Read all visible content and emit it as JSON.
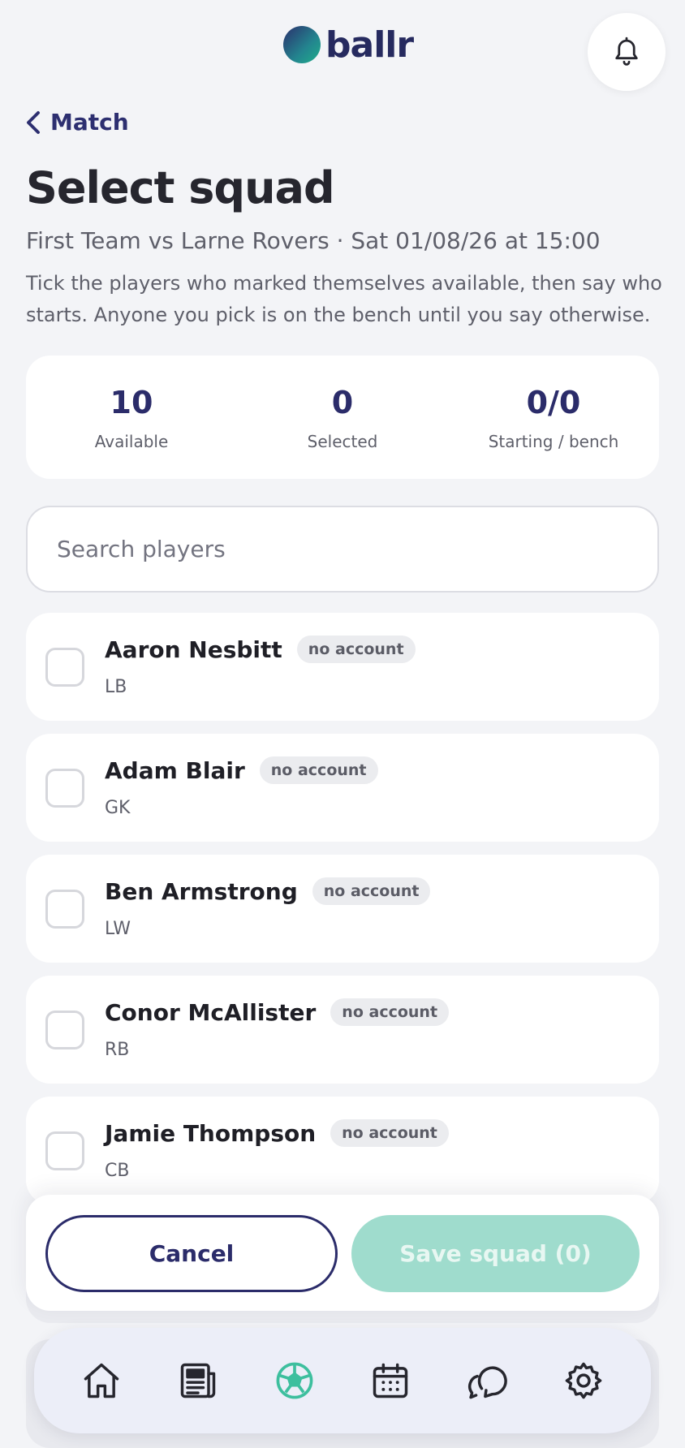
{
  "app": {
    "logo_text": "ballr"
  },
  "header": {
    "back_label": "Match"
  },
  "page": {
    "title": "Select squad",
    "subtitle": "First Team vs Larne Rovers · Sat 01/08/26 at 15:00",
    "description": "Tick the players who marked themselves available, then say who starts. Anyone you pick is on the bench until you say otherwise."
  },
  "stats": [
    {
      "value": "10",
      "label": "Available"
    },
    {
      "value": "0",
      "label": "Selected"
    },
    {
      "value": "0/0",
      "label": "Starting / bench"
    }
  ],
  "search": {
    "placeholder": "Search players",
    "value": ""
  },
  "players": [
    {
      "name": "Aaron Nesbitt",
      "badge": "no account",
      "position": "LB",
      "checked": false
    },
    {
      "name": "Adam Blair",
      "badge": "no account",
      "position": "GK",
      "checked": false
    },
    {
      "name": "Ben Armstrong",
      "badge": "no account",
      "position": "LW",
      "checked": false
    },
    {
      "name": "Conor McAllister",
      "badge": "no account",
      "position": "RB",
      "checked": false
    },
    {
      "name": "Jamie Thompson",
      "badge": "no account",
      "position": "CB",
      "checked": false
    }
  ],
  "actions": {
    "cancel_label": "Cancel",
    "save_label": "Save squad (0)"
  },
  "nav": {
    "items": [
      {
        "icon": "home-icon",
        "active": false
      },
      {
        "icon": "news-icon",
        "active": false
      },
      {
        "icon": "football-icon",
        "active": true
      },
      {
        "icon": "calendar-icon",
        "active": false
      },
      {
        "icon": "chat-icon",
        "active": false
      },
      {
        "icon": "settings-icon",
        "active": false
      }
    ]
  },
  "colors": {
    "brand_navy": "#2b2c6a",
    "brand_green": "#3dbf9e",
    "save_disabled": "#9fdccd",
    "background": "#f3f4f7"
  }
}
